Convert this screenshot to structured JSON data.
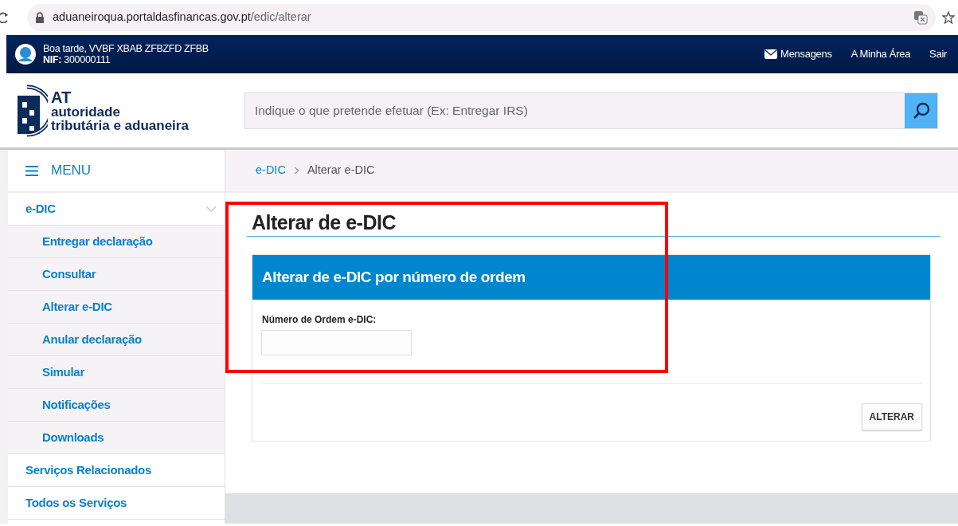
{
  "browser": {
    "url_host": "aduaneiroqua.portaldasfinancas.gov.pt",
    "url_path": "/edic/alterar"
  },
  "topbar": {
    "greeting": "Boa tarde, VVBF XBAB ZFBZFD ZFBB",
    "nif_label": "NIF:",
    "nif": "300000111",
    "links": [
      {
        "label": "Mensagens",
        "kind": "mail"
      },
      {
        "label": "A Minha Área",
        "kind": "plain"
      },
      {
        "label": "Sair",
        "kind": "plain"
      }
    ]
  },
  "header": {
    "logo_abbr": "AT",
    "logo_line1": "autoridade",
    "logo_line2": "tributária e aduaneira",
    "search": {
      "placeholder": "Indique o que pretende efetuar (Ex: Entregar IRS)"
    }
  },
  "sidebar": {
    "menu_label": "MENU",
    "items": [
      {
        "label": "e-DIC",
        "expanded": true,
        "children": [
          {
            "label": "Entregar declaração"
          },
          {
            "label": "Consultar"
          },
          {
            "label": "Alterar e-DIC"
          },
          {
            "label": "Anular declaração"
          },
          {
            "label": "Simular"
          },
          {
            "label": "Notificações"
          },
          {
            "label": "Downloads"
          }
        ]
      },
      {
        "label": "Serviços Relacionados"
      },
      {
        "label": "Todos os Serviços"
      }
    ]
  },
  "breadcrumb": [
    {
      "label": "e-DIC",
      "kind": "link"
    },
    {
      "label": "Alterar e-DIC",
      "kind": "current"
    }
  ],
  "page_title": "Alterar de e-DIC",
  "panel": {
    "title": "Alterar de e-DIC por número de ordem",
    "field_label": "Número de Ordem e-DIC:",
    "button": "ALTERAR"
  },
  "annotation": {
    "kind": "frame"
  }
}
